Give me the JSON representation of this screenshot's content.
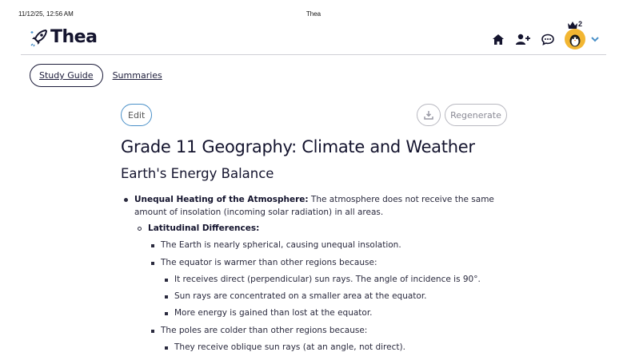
{
  "print_header": {
    "datetime": "11/12/25, 12:56 AM",
    "title": "Thea"
  },
  "app": {
    "name": "Thea",
    "crown_count": "2",
    "icons": [
      "home-icon",
      "add-user-icon",
      "chat-icon",
      "avatar",
      "chevron-down-icon"
    ]
  },
  "tabs": {
    "study_guide": "Study Guide",
    "summaries": "Summaries"
  },
  "toolbar": {
    "edit": "Edit",
    "regenerate": "Regenerate"
  },
  "document": {
    "title": "Grade 11 Geography: Climate and Weather",
    "section": "Earth's Energy Balance",
    "item1_bold": "Unequal Heating of the Atmosphere:",
    "item1_text": " The atmosphere does not receive the same amount of insolation (incoming solar radiation) in all areas.",
    "sub_heading": "Latitudinal Differences:",
    "p1": "The Earth is nearly spherical, causing unequal insolation.",
    "p2": "The equator is warmer than other regions because:",
    "p2a": "It receives direct (perpendicular) sun rays. The angle of incidence is 90°.",
    "p2b": "Sun rays are concentrated on a smaller area at the equator.",
    "p2c": "More energy is gained than lost at the equator.",
    "p3": "The poles are colder than other regions because:",
    "p3a": "They receive oblique sun rays (at an angle, not direct)."
  },
  "colors": {
    "accent_blue": "#4a90c8",
    "text_dark": "#14142e",
    "avatar_bg": "#f2b632"
  }
}
